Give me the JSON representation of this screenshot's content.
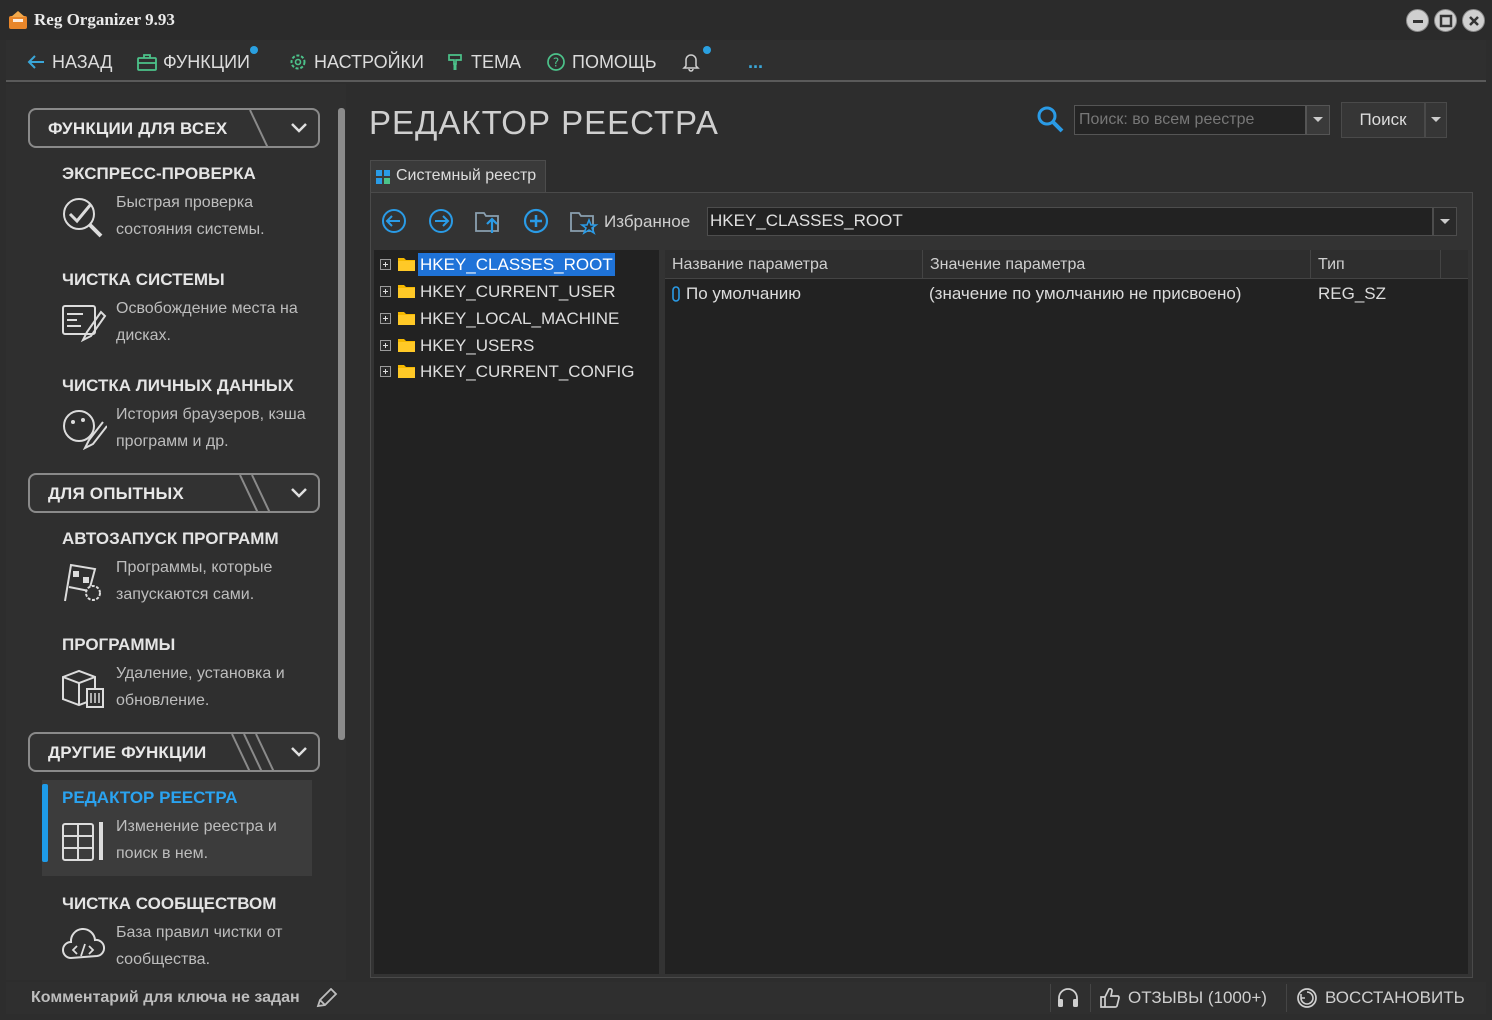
{
  "window": {
    "title": "Reg Organizer 9.93"
  },
  "menu": {
    "back": "НАЗАД",
    "functions": "ФУНКЦИИ",
    "settings": "НАСТРОЙКИ",
    "theme": "ТЕМА",
    "help": "ПОМОЩЬ",
    "more": "..."
  },
  "sidebar": {
    "sections": [
      {
        "label": "ФУНКЦИИ ДЛЯ ВСЕХ"
      },
      {
        "label": "ДЛЯ ОПЫТНЫХ"
      },
      {
        "label": "ДРУГИЕ ФУНКЦИИ"
      }
    ],
    "items": [
      {
        "title": "ЭКСПРЕСС-ПРОВЕРКА",
        "desc": "Быстрая проверка состояния системы."
      },
      {
        "title": "ЧИСТКА СИСТЕМЫ",
        "desc": "Освобождение места на дисках."
      },
      {
        "title": "ЧИСТКА ЛИЧНЫХ ДАННЫХ",
        "desc": "История браузеров, кэша программ и др."
      },
      {
        "title": "АВТОЗАПУСК ПРОГРАММ",
        "desc": "Программы, которые запускаются сами."
      },
      {
        "title": "ПРОГРАММЫ",
        "desc": "Удаление, установка и обновление."
      },
      {
        "title": "РЕДАКТОР РЕЕСТРА",
        "desc": "Изменение реестра и поиск в нем."
      },
      {
        "title": "ЧИСТКА СООБЩЕСТВОМ",
        "desc": "База правил чистки от сообщества."
      }
    ]
  },
  "main": {
    "title": "РЕДАКТОР РЕЕСТРА",
    "search": {
      "placeholder": "Поиск: во всем реестре",
      "button": "Поиск"
    },
    "tab": "Системный реестр",
    "toolbar": {
      "favorites": "Избранное",
      "path": "HKEY_CLASSES_ROOT"
    },
    "tree": [
      {
        "label": "HKEY_CLASSES_ROOT",
        "selected": true
      },
      {
        "label": "HKEY_CURRENT_USER"
      },
      {
        "label": "HKEY_LOCAL_MACHINE"
      },
      {
        "label": "HKEY_USERS"
      },
      {
        "label": "HKEY_CURRENT_CONFIG"
      }
    ],
    "params": {
      "columns": [
        "Название параметра",
        "Значение параметра",
        "Тип"
      ],
      "rows": [
        {
          "name": "По умолчанию",
          "value": "(значение по умолчанию не присвоено)",
          "type": "REG_SZ"
        }
      ]
    }
  },
  "status": {
    "comment": "Комментарий для ключа не задан",
    "reviews": "ОТЗЫВЫ (1000+)",
    "restore": "ВОССТАНОВИТЬ"
  },
  "colors": {
    "accent": "#2aa3f0",
    "selection": "#1f73d8",
    "folder": "#f5b800"
  }
}
